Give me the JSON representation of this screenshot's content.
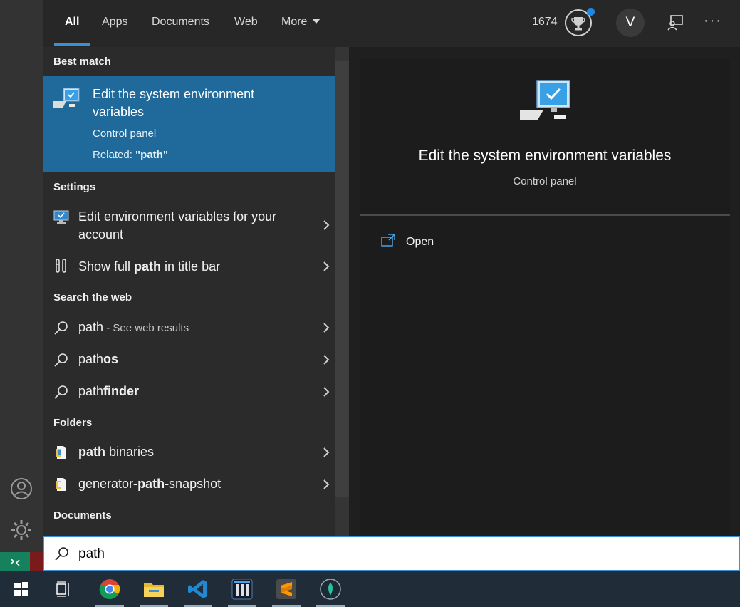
{
  "tabs": [
    "All",
    "Apps",
    "Documents",
    "Web",
    "More"
  ],
  "header": {
    "points": "1674",
    "avatar_letter": "V"
  },
  "sections": {
    "best_match": "Best match",
    "settings": "Settings",
    "search_web": "Search the web",
    "folders": "Folders",
    "documents": "Documents"
  },
  "best_match": {
    "title": "Edit the system environment variables",
    "subtitle": "Control panel",
    "related_prefix": "Related: ",
    "related_term": "\"path\""
  },
  "settings_items": [
    {
      "label": "Edit environment variables for your account"
    },
    {
      "pre": "Show full ",
      "bold": "path",
      "post": " in title bar"
    }
  ],
  "web_items": [
    {
      "bold": "path",
      "suffix": " - See web results"
    },
    {
      "pre": "path",
      "bold": "os"
    },
    {
      "pre": "path",
      "bold": "finder"
    }
  ],
  "folder_items": [
    {
      "bold": "path",
      "post": " binaries"
    },
    {
      "pre": "generator-",
      "bold": "path",
      "post": "-snapshot"
    }
  ],
  "preview": {
    "title": "Edit the system environment variables",
    "subtitle": "Control panel",
    "open_label": "Open"
  },
  "search": {
    "value": "path"
  },
  "icons": {
    "account": "account-icon",
    "settings": "gear-icon",
    "trophy": "trophy-icon",
    "feedback": "feedback-icon",
    "more": "ellipsis-icon",
    "search": "search-icon",
    "chevron": "chevron-right-icon",
    "open": "open-icon"
  },
  "colors": {
    "accent": "#3c8fd6",
    "best_match_bg": "#1f6a9a",
    "taskbar": "#202d39"
  }
}
